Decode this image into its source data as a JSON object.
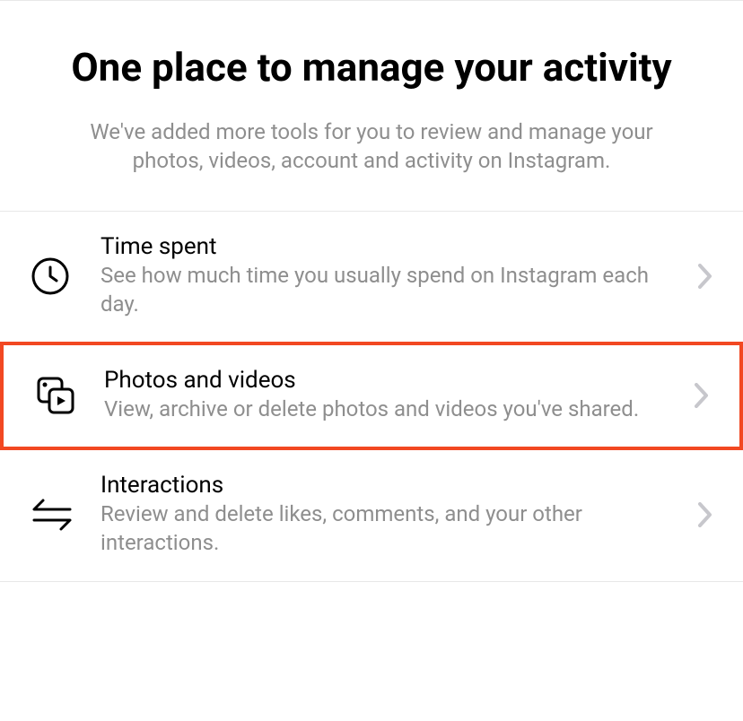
{
  "header": {
    "title": "One place to manage your activity",
    "subtitle": "We've added more tools for you to review and manage your photos, videos, account and activity on Instagram."
  },
  "items": [
    {
      "title": "Time spent",
      "desc": "See how much time you usually spend on Instagram each day."
    },
    {
      "title": "Photos and videos",
      "desc": "View, archive or delete photos and videos you've shared."
    },
    {
      "title": "Interactions",
      "desc": "Review and delete likes, comments, and your other interactions."
    }
  ]
}
